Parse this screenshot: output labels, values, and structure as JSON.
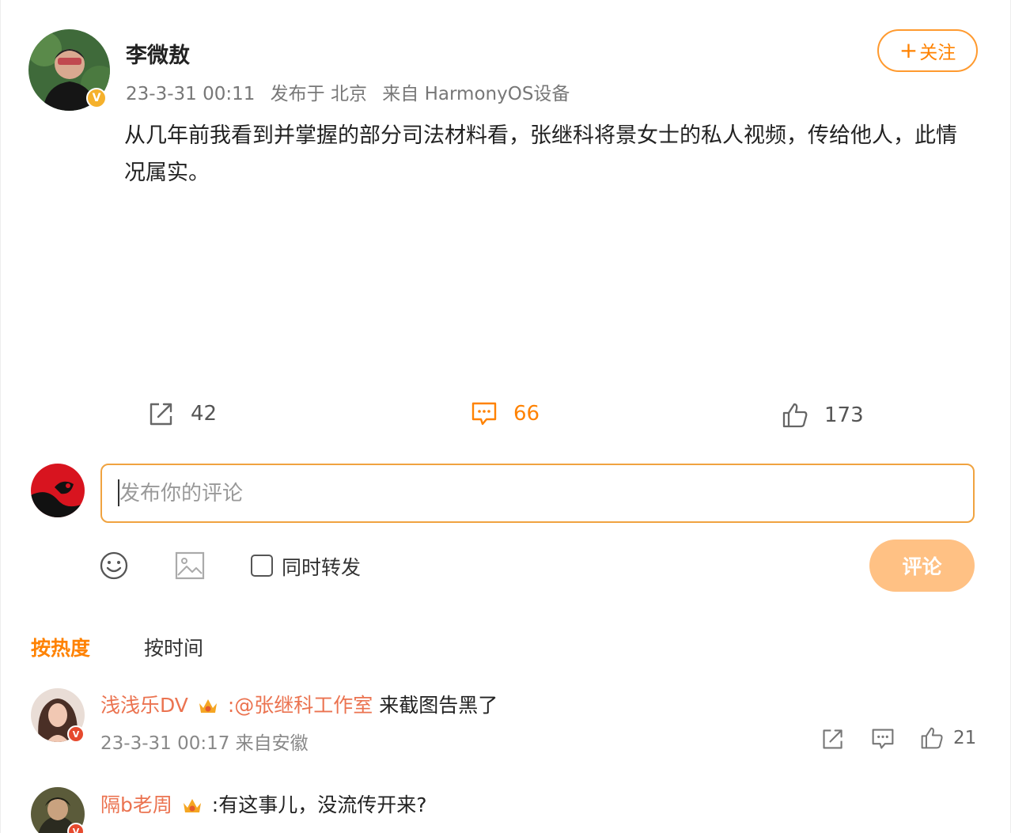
{
  "post": {
    "author": "李微敖",
    "meta": {
      "date": "23-3-31 00:11",
      "location": "发布于 北京",
      "source": "来自 HarmonyOS设备"
    },
    "follow_label": "关注",
    "follow_plus": "+",
    "verified_badge": "V",
    "content": "从几年前我看到并掌握的部分司法材料看，张继科将景女士的私人视频，传给他人，此情况属实。"
  },
  "stats": {
    "repost": "42",
    "comments": "66",
    "likes": "173"
  },
  "composer": {
    "placeholder": "发布你的评论",
    "repost_label": "同时转发",
    "submit_label": "评论",
    "icons": [
      "smile-icon",
      "image-icon"
    ]
  },
  "sort_tabs": [
    "按热度",
    "按时间"
  ],
  "comments": [
    {
      "name": "浅浅乐DV",
      "mention": ":@张继科工作室",
      "text": "来截图告黑了",
      "meta": "23-3-31 00:17 来自安徽",
      "likes": "21",
      "badge": "V"
    },
    {
      "name": "隔b老周",
      "text": ":有这事儿，没流传开来?",
      "badge": "V"
    }
  ],
  "colors": {
    "accent": "#ff8200",
    "name": "#eb7350",
    "submit_disabled": "#ffc184"
  }
}
